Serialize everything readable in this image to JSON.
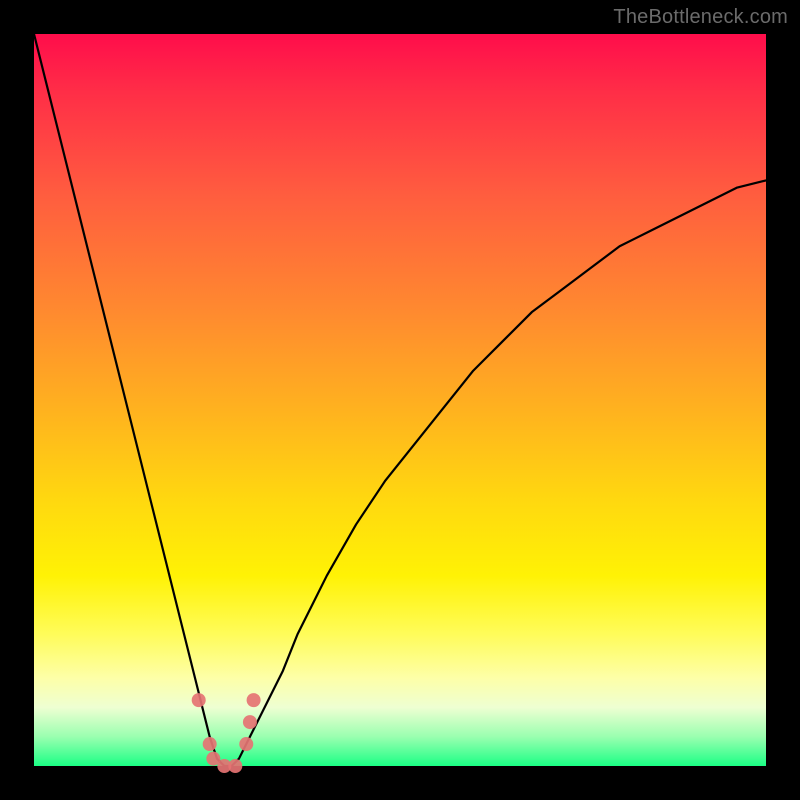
{
  "watermark": "TheBottleneck.com",
  "colors": {
    "frame": "#000000",
    "curve": "#000000",
    "marker": "#e57373",
    "gradient_top": "#ff0d4b",
    "gradient_bottom": "#1bff85"
  },
  "chart_data": {
    "type": "line",
    "title": "",
    "xlabel": "",
    "ylabel": "",
    "xlim": [
      0,
      100
    ],
    "ylim": [
      0,
      100
    ],
    "x": [
      0,
      2,
      4,
      6,
      8,
      10,
      12,
      14,
      16,
      18,
      20,
      22,
      23,
      24,
      25,
      26,
      27,
      28,
      29,
      30,
      32,
      34,
      36,
      38,
      40,
      44,
      48,
      52,
      56,
      60,
      64,
      68,
      72,
      76,
      80,
      84,
      88,
      92,
      96,
      100
    ],
    "y": [
      100,
      92,
      84,
      76,
      68,
      60,
      52,
      44,
      36,
      28,
      20,
      12,
      8,
      4,
      1,
      0,
      0,
      1,
      3,
      5,
      9,
      13,
      18,
      22,
      26,
      33,
      39,
      44,
      49,
      54,
      58,
      62,
      65,
      68,
      71,
      73,
      75,
      77,
      79,
      80
    ],
    "markers": [
      {
        "x": 22.5,
        "y": 9
      },
      {
        "x": 24.0,
        "y": 3
      },
      {
        "x": 24.5,
        "y": 1
      },
      {
        "x": 26.0,
        "y": 0
      },
      {
        "x": 27.5,
        "y": 0
      },
      {
        "x": 29.0,
        "y": 3
      },
      {
        "x": 29.5,
        "y": 6
      },
      {
        "x": 30.0,
        "y": 9
      }
    ],
    "marker_radius": 7
  }
}
